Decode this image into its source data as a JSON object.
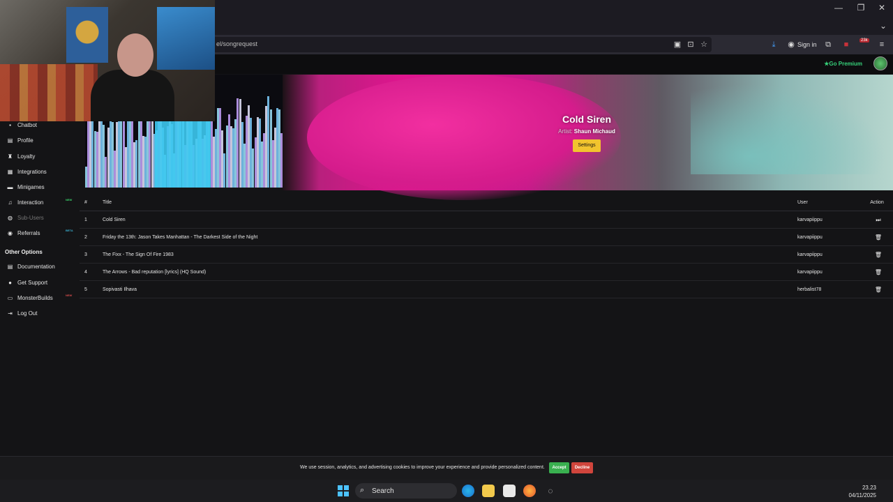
{
  "browser": {
    "url_text": "el/songrequest",
    "sign_in_label": "Sign in",
    "badge_count": "23k",
    "window_buttons": [
      "—",
      "❐",
      "✕"
    ]
  },
  "site": {
    "premium_label": "★Go Premium"
  },
  "sidebar": {
    "items": [
      {
        "label": "Chatbot",
        "icon": "chat-icon"
      },
      {
        "label": "Profile",
        "icon": "profile-icon"
      },
      {
        "label": "Loyalty",
        "icon": "trophy-icon"
      },
      {
        "label": "Integrations",
        "icon": "integrations-icon"
      },
      {
        "label": "Minigames",
        "icon": "gamepad-icon"
      },
      {
        "label": "Interaction",
        "icon": "music-icon",
        "tag": "NEW"
      },
      {
        "label": "Sub-Users",
        "icon": "users-icon"
      },
      {
        "label": "Referrals",
        "icon": "referrals-icon",
        "tag": "BETA"
      }
    ],
    "other_heading": "Other Options",
    "other_items": [
      {
        "label": "Documentation",
        "icon": "document-icon"
      },
      {
        "label": "Get Support",
        "icon": "support-icon"
      },
      {
        "label": "MonsterBuilds",
        "icon": "laptop-icon",
        "tag": "NEW"
      },
      {
        "label": "Log Out",
        "icon": "logout-icon"
      }
    ]
  },
  "now_playing": {
    "title": "Cold Siren",
    "artist_label": "Artist:",
    "artist": "Shaun Michaud",
    "settings_label": "Settings"
  },
  "queue": {
    "headers": {
      "num": "#",
      "title": "Title",
      "user": "User",
      "action": "Action"
    },
    "rows": [
      {
        "num": "1",
        "title": "Cold Siren",
        "user": "karvapiippu",
        "action": "skip"
      },
      {
        "num": "2",
        "title": "Friday the 13th: Jason Takes Manhattan - The Darkest Side of the Night",
        "user": "karvapiippu",
        "action": "delete"
      },
      {
        "num": "3",
        "title": "The Fixx - The Sign Of Fire 1983",
        "user": "karvapiippu",
        "action": "delete"
      },
      {
        "num": "4",
        "title": "The Arrows - Bad reputation [lyrics] (HQ Sound)",
        "user": "karvapiippu",
        "action": "delete"
      },
      {
        "num": "5",
        "title": "Sopivasti Ilhava",
        "user": "herbalist78",
        "action": "delete"
      }
    ]
  },
  "cookie": {
    "text": "We use session, analytics, and advertising cookies to improve your experience and provide personalized content.",
    "accept": "Accept",
    "decline": "Decline"
  },
  "taskbar": {
    "search_placeholder": "Search",
    "time": "23.23",
    "date": "04/11/2025"
  }
}
